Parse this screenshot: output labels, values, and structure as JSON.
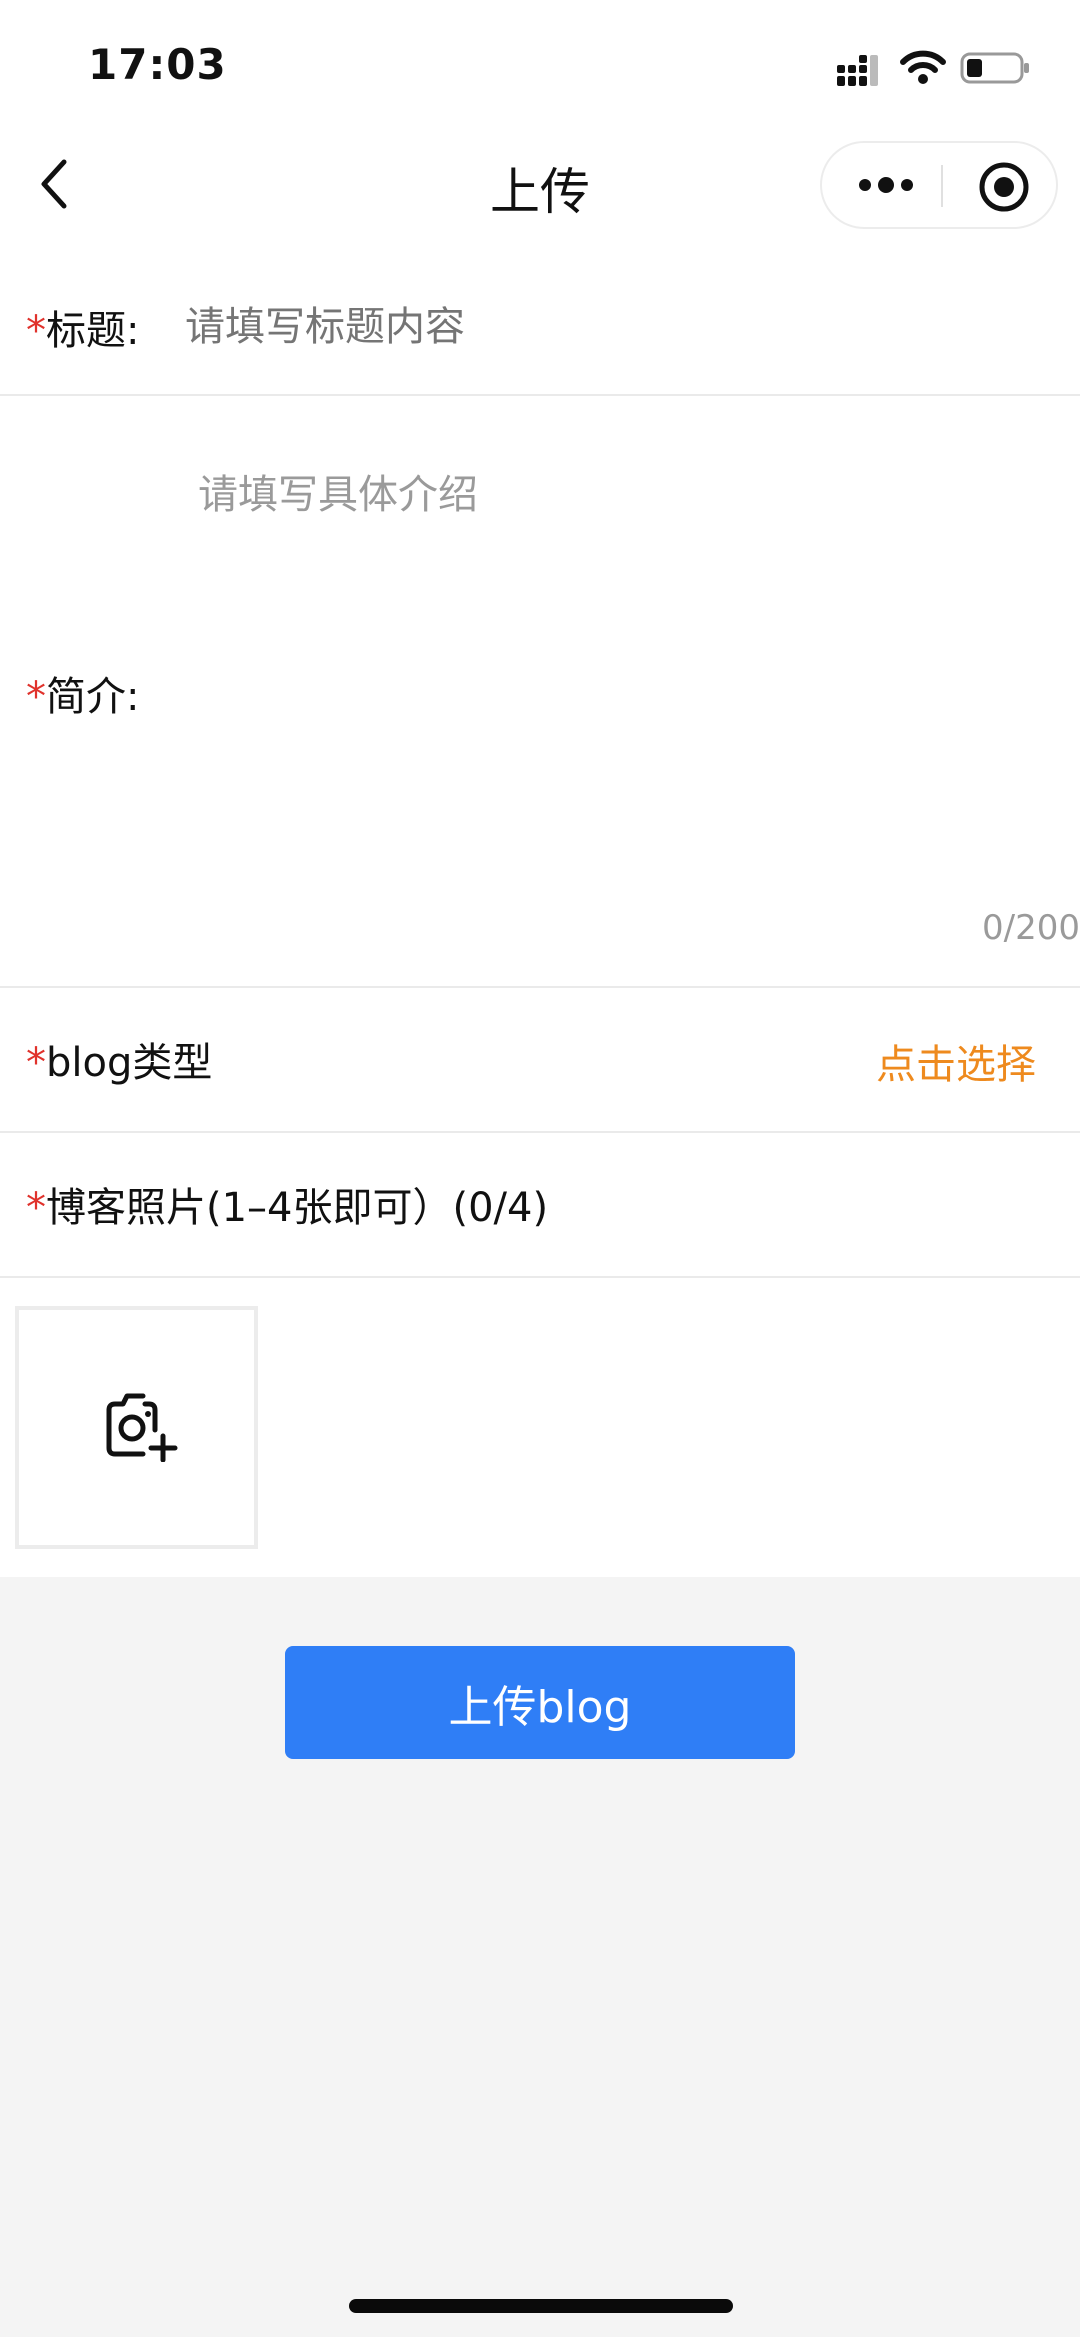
{
  "status_bar": {
    "time": "17:03",
    "signal_icon": "signal-icon",
    "wifi_icon": "wifi-icon",
    "battery_icon": "battery-icon",
    "battery_level": 0.3
  },
  "nav": {
    "back_icon": "chevron-left-icon",
    "title": "上传",
    "more_icon": "more-dots-icon",
    "target_icon": "target-circle-icon"
  },
  "form": {
    "required_mark": "*",
    "title": {
      "label": "标题:",
      "placeholder": "请填写标题内容"
    },
    "intro": {
      "label": "简介:",
      "placeholder": "请填写具体介绍",
      "counter": "0/200"
    },
    "type": {
      "label": "blog类型",
      "select_text": "点击选择"
    },
    "photos": {
      "label": "博客照片(1–4张即可）(0/4)",
      "add_icon": "camera-plus-icon"
    }
  },
  "submit": {
    "label": "上传blog"
  },
  "colors": {
    "accent_blue": "#2f7ef6",
    "required_red": "#e0322c",
    "select_orange": "#ee8a1e",
    "placeholder_gray": "#9a9a9a",
    "page_bg": "#f4f4f4"
  }
}
